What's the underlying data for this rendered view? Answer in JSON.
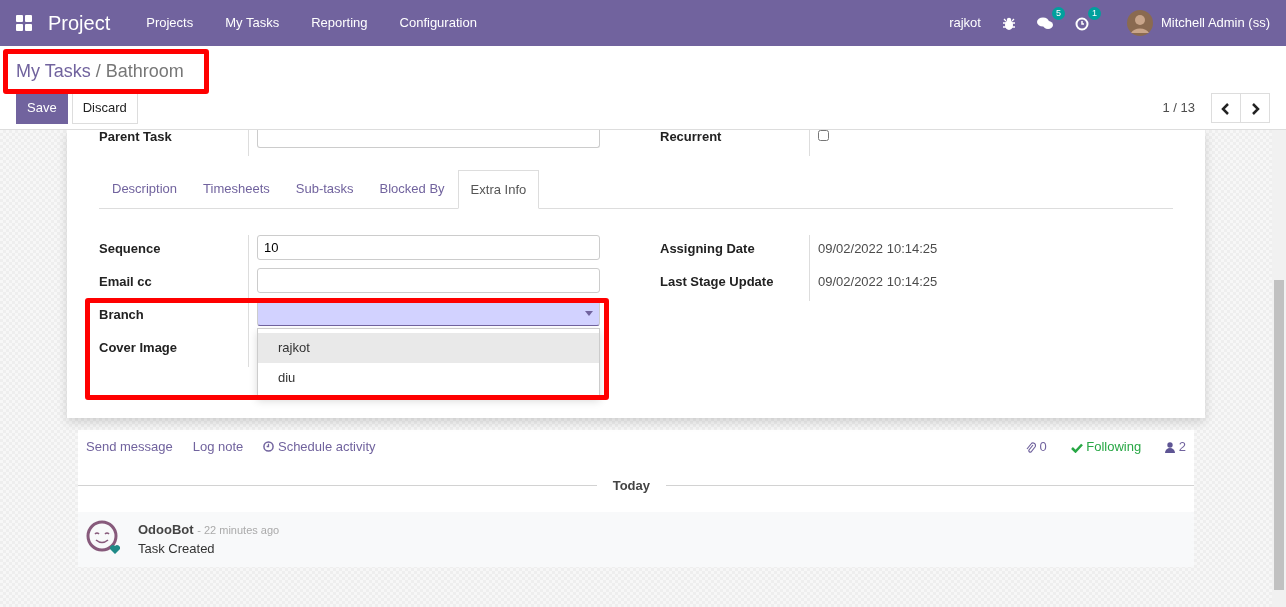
{
  "navbar": {
    "app_name": "Project",
    "menu": [
      {
        "label": "Projects"
      },
      {
        "label": "My Tasks"
      },
      {
        "label": "Reporting"
      },
      {
        "label": "Configuration"
      }
    ],
    "company": "rajkot",
    "messages_badge": "5",
    "activities_badge": "1",
    "user": "Mitchell Admin (ss)"
  },
  "breadcrumb": {
    "parent": "My Tasks",
    "separator": "/",
    "current": "Bathroom"
  },
  "buttons": [
    {
      "label": "Save",
      "kind": "primary"
    },
    {
      "label": "Discard",
      "kind": "secondary"
    }
  ],
  "pager": {
    "text": "1 / 13"
  },
  "top_fields": {
    "left": {
      "label": "Parent Task"
    },
    "right": {
      "label": "Recurrent",
      "checked": false
    }
  },
  "tabs": [
    {
      "label": "Description",
      "selected": false
    },
    {
      "label": "Timesheets",
      "selected": false
    },
    {
      "label": "Sub-tasks",
      "selected": false
    },
    {
      "label": "Blocked By",
      "selected": false
    },
    {
      "label": "Extra Info",
      "selected": true
    }
  ],
  "left_fields": [
    {
      "label": "Sequence",
      "kind": "input",
      "value": "10"
    },
    {
      "label": "Email cc",
      "kind": "input"
    },
    {
      "label": "Branch",
      "kind": "select",
      "expanded": true,
      "options": [
        {
          "label": "rajkot",
          "selected": true
        },
        {
          "label": "diu",
          "selected": false
        }
      ]
    },
    {
      "label": "Cover Image",
      "kind": "empty"
    }
  ],
  "right_fields": [
    {
      "label": "Assigning Date",
      "value": "09/02/2022 10:14:25"
    },
    {
      "label": "Last Stage Update",
      "value": "09/02/2022 10:14:25"
    }
  ],
  "chatter": {
    "actions": [
      {
        "label": "Send message",
        "kind": "plain"
      },
      {
        "label": "Log note",
        "kind": "plain"
      },
      {
        "label": "Schedule activity",
        "kind": "clock"
      }
    ],
    "attachments": "0",
    "follow": "Following",
    "followers": "2",
    "separator": "Today",
    "messages": [
      {
        "author": "OdooBot",
        "time": "- 22 minutes ago",
        "body": "Task Created"
      }
    ]
  }
}
